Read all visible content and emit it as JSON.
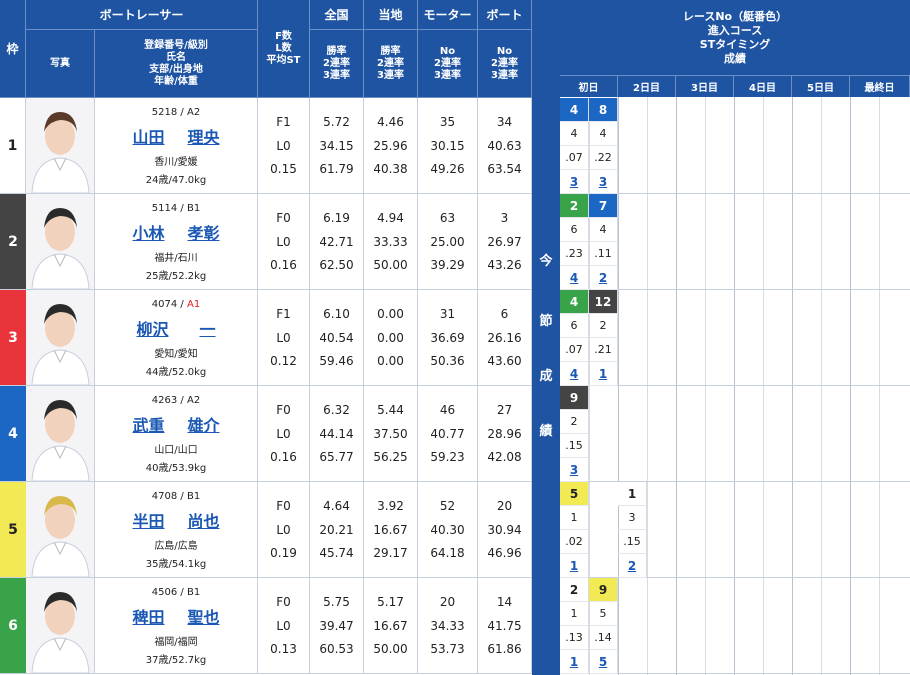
{
  "header": {
    "waku": "枠",
    "racer": "ボートレーサー",
    "photo": "写真",
    "info": [
      "登録番号/級別",
      "氏名",
      "支部/出身地",
      "年齢/体重"
    ],
    "fst": [
      "F数",
      "L数",
      "平均ST"
    ],
    "zenkoku": "全国",
    "zenkoku_sub": [
      "勝率",
      "2連率",
      "3連率"
    ],
    "touchi": "当地",
    "touchi_sub": [
      "勝率",
      "2連率",
      "3連率"
    ],
    "motor": "モーター",
    "motor_sub": [
      "No",
      "2連率",
      "3連率"
    ],
    "boat": "ボート",
    "boat_sub": [
      "No",
      "2連率",
      "3連率"
    ]
  },
  "middle": [
    "今",
    "節",
    "成",
    "績"
  ],
  "right_header": [
    "レースNo（艇番色）",
    "進入コース",
    "STタイミング",
    "成績"
  ],
  "days": [
    "初日",
    "2日目",
    "3日目",
    "4日目",
    "5日目",
    "最終日"
  ],
  "colors": {
    "1": "#ffffff",
    "2": "#444444",
    "3": "#e8343a",
    "4": "#1d67c4",
    "5": "#f2ea55",
    "6": "#38a348",
    "header": "#1f54a3"
  },
  "racers": [
    {
      "waku": "1",
      "reg": "5218 / A2",
      "sei": "山田",
      "mei": "理央",
      "home": "香川/愛媛",
      "age": "24歳/47.0kg",
      "f": "F1",
      "l": "L0",
      "st": "0.15",
      "zenkoku": [
        "5.72",
        "34.15",
        "61.79"
      ],
      "touchi": [
        "4.46",
        "25.96",
        "40.38"
      ],
      "motor": [
        "35",
        "30.15",
        "49.26"
      ],
      "boat": [
        "34",
        "40.63",
        "63.54"
      ],
      "results": [
        {
          "race": "4",
          "course": "4",
          "st": ".07",
          "rank": "3",
          "boat": "4"
        },
        {
          "race": "8",
          "course": "4",
          "st": ".22",
          "rank": "3",
          "boat": "4"
        }
      ]
    },
    {
      "waku": "2",
      "reg": "5114 / B1",
      "sei": "小林",
      "mei": "孝彰",
      "home": "福井/石川",
      "age": "25歳/52.2kg",
      "f": "F0",
      "l": "L0",
      "st": "0.16",
      "zenkoku": [
        "6.19",
        "42.71",
        "62.50"
      ],
      "touchi": [
        "4.94",
        "33.33",
        "50.00"
      ],
      "motor": [
        "63",
        "25.00",
        "39.29"
      ],
      "boat": [
        "3",
        "26.97",
        "43.26"
      ],
      "results": [
        {
          "race": "2",
          "course": "6",
          "st": ".23",
          "rank": "4",
          "boat": "6"
        },
        {
          "race": "7",
          "course": "4",
          "st": ".11",
          "rank": "2",
          "boat": "4"
        }
      ]
    },
    {
      "waku": "3",
      "reg": "4074 / ",
      "cls": "A1",
      "sei": "柳沢",
      "mei": "一",
      "home": "愛知/愛知",
      "age": "44歳/52.0kg",
      "f": "F1",
      "l": "L0",
      "st": "0.12",
      "zenkoku": [
        "6.10",
        "40.54",
        "59.46"
      ],
      "touchi": [
        "0.00",
        "0.00",
        "0.00"
      ],
      "motor": [
        "31",
        "36.69",
        "50.36"
      ],
      "boat": [
        "6",
        "26.16",
        "43.60"
      ],
      "results": [
        {
          "race": "4",
          "course": "6",
          "st": ".07",
          "rank": "4",
          "boat": "6"
        },
        {
          "race": "12",
          "course": "2",
          "st": ".21",
          "rank": "1",
          "boat": "2"
        }
      ]
    },
    {
      "waku": "4",
      "reg": "4263 / A2",
      "sei": "武重",
      "mei": "雄介",
      "home": "山口/山口",
      "age": "40歳/53.9kg",
      "f": "F0",
      "l": "L0",
      "st": "0.16",
      "zenkoku": [
        "6.32",
        "44.14",
        "65.77"
      ],
      "touchi": [
        "5.44",
        "37.50",
        "56.25"
      ],
      "motor": [
        "46",
        "40.77",
        "59.23"
      ],
      "boat": [
        "27",
        "28.96",
        "42.08"
      ],
      "results": [
        {
          "race": "9",
          "course": "2",
          "st": ".15",
          "rank": "3",
          "boat": "2"
        }
      ]
    },
    {
      "waku": "5",
      "reg": "4708 / B1",
      "sei": "半田",
      "mei": "尚也",
      "home": "広島/広島",
      "age": "35歳/54.1kg",
      "f": "F0",
      "l": "L0",
      "st": "0.19",
      "zenkoku": [
        "4.64",
        "20.21",
        "45.74"
      ],
      "touchi": [
        "3.92",
        "16.67",
        "29.17"
      ],
      "motor": [
        "52",
        "40.30",
        "64.18"
      ],
      "boat": [
        "20",
        "30.94",
        "46.96"
      ],
      "results": [
        {
          "race": "5",
          "course": "1",
          "st": ".02",
          "rank": "1",
          "boat": "5"
        },
        {
          "race": "1",
          "course": "3",
          "st": ".15",
          "rank": "2",
          "boat": "1",
          "day": 1
        }
      ]
    },
    {
      "waku": "6",
      "reg": "4506 / B1",
      "sei": "稗田",
      "mei": "聖也",
      "home": "福岡/福岡",
      "age": "37歳/52.7kg",
      "f": "F0",
      "l": "L0",
      "st": "0.13",
      "zenkoku": [
        "5.75",
        "39.47",
        "60.53"
      ],
      "touchi": [
        "5.17",
        "16.67",
        "50.00"
      ],
      "motor": [
        "20",
        "34.33",
        "53.73"
      ],
      "boat": [
        "14",
        "41.75",
        "61.86"
      ],
      "results": [
        {
          "race": "2",
          "course": "1",
          "st": ".13",
          "rank": "1",
          "boat": "1"
        },
        {
          "race": "9",
          "course": "5",
          "st": ".14",
          "rank": "5",
          "boat": "5"
        }
      ]
    }
  ]
}
